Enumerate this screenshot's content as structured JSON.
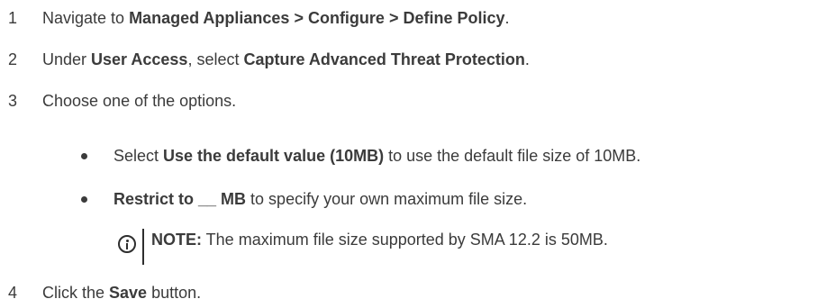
{
  "steps": [
    {
      "num": "1",
      "pre": "Navigate to ",
      "bold": "Managed Appliances > Configure > Define Policy",
      "post": "."
    },
    {
      "num": "2",
      "pre": "Under ",
      "bold": "User Access",
      "mid": ", select ",
      "bold2": "Capture Advanced Threat Protection",
      "post": "."
    },
    {
      "num": "3",
      "text": "Choose one of the options."
    },
    {
      "num": "4",
      "pre": "Click the ",
      "bold": "Save",
      "post": " button."
    }
  ],
  "bullets": [
    {
      "pre": "Select ",
      "bold": "Use the default value (10MB)",
      "post": " to use the default file size of 10MB."
    },
    {
      "bold": "Restrict to __ MB",
      "post": " to specify your own maximum file size."
    }
  ],
  "note": {
    "label": "NOTE:",
    "text": " The maximum file size supported by SMA 12.2 is 50MB."
  }
}
